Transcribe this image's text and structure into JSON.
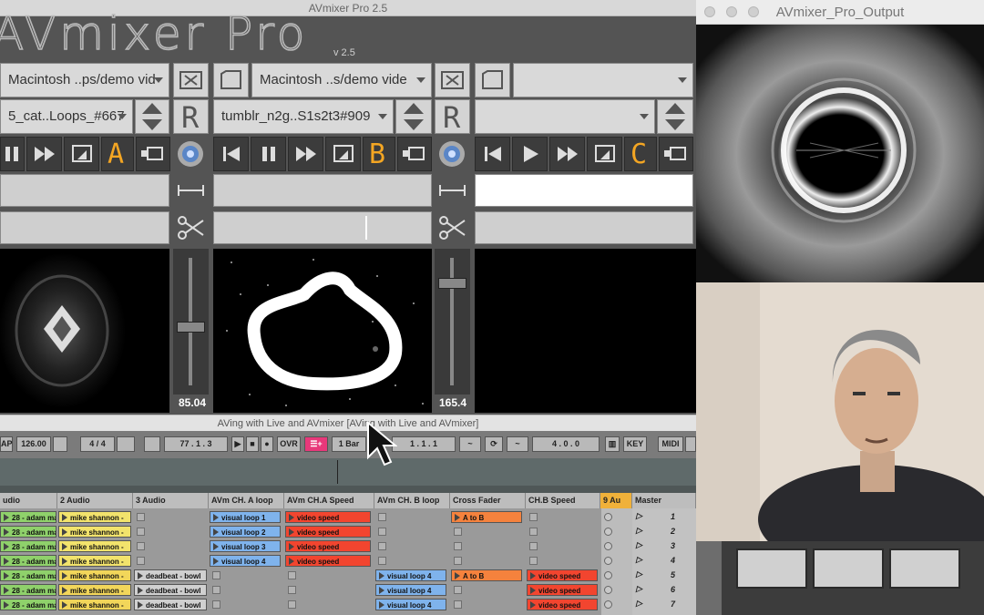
{
  "mixer": {
    "window_title": "AVmixer Pro 2.5",
    "logo_text": "AVmixer Pro",
    "version": "v 2.5",
    "channels": [
      {
        "source": "Macintosh ..ps/demo vid",
        "clip": "5_cat..Loops_#667",
        "letter": "A",
        "fader_value": "85.04"
      },
      {
        "source": "Macintosh ..s/demo vide",
        "clip": "tumblr_n2g..S1s2t3#909",
        "letter": "B",
        "fader_value": "165.4"
      },
      {
        "source": "",
        "clip": "",
        "letter": "C",
        "fader_value": ""
      }
    ],
    "accent_color": "#f4a623"
  },
  "output": {
    "window_title": "AVmixer_Pro_Output"
  },
  "live": {
    "window_title": "AVing with Live and AVmixer  [AVing with Live and AVmixer]",
    "transport": {
      "tap": "AP",
      "tempo": "126.00",
      "signature": "4 / 4",
      "position": "77 .  1 .  3",
      "ovr": "OVR",
      "quant": "1 Bar",
      "loop_start": "1 .  1 .  1",
      "loop_len": "4 .  0 .  0",
      "key": "KEY",
      "midi": "MIDI"
    },
    "tracks": [
      {
        "name": "udio"
      },
      {
        "name": "2 Audio"
      },
      {
        "name": "3 Audio"
      },
      {
        "name": "AVm CH. A loop"
      },
      {
        "name": "AVm CH.A Speed"
      },
      {
        "name": "AVm CH. B loop"
      },
      {
        "name": "Cross Fader"
      },
      {
        "name": "CH.B Speed"
      },
      {
        "name": "9 Au"
      },
      {
        "name": "Master"
      }
    ],
    "clip_labels": {
      "adam": "28 - adam marc",
      "mike": "mike shannon -",
      "deadbeat": "deadbeat - bowl",
      "loop1": "visual loop 1",
      "loop2": "visual loop 2",
      "loop3": "visual loop 3",
      "loop4": "visual loop 4",
      "speed": "video speed",
      "atob": "A to B"
    },
    "scenes": [
      "1",
      "2",
      "3",
      "4",
      "5",
      "6",
      "7"
    ]
  }
}
